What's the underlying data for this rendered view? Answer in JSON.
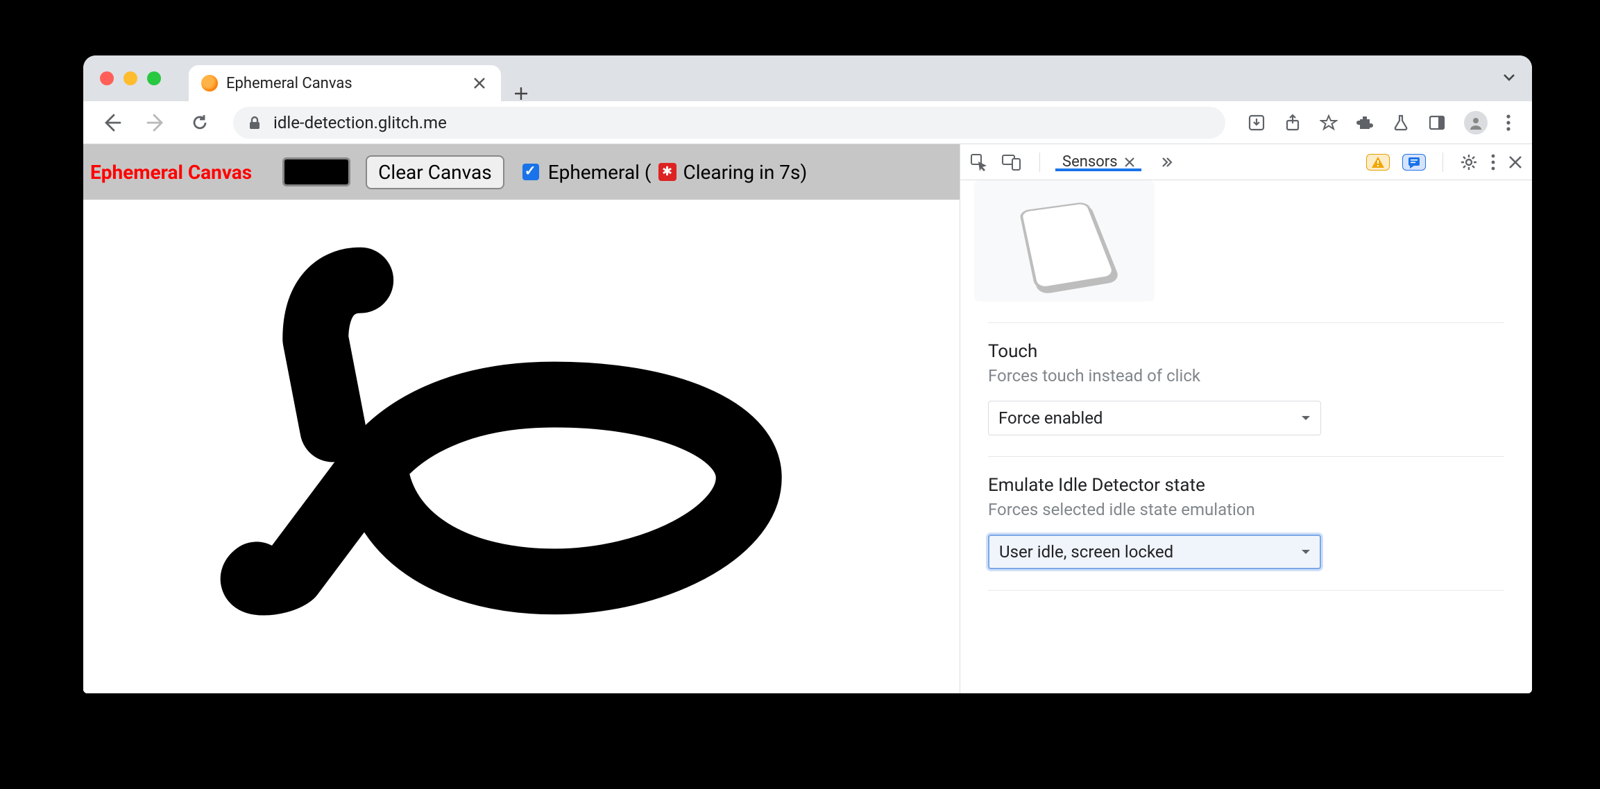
{
  "browser": {
    "tab_title": "Ephemeral Canvas",
    "url": "idle-detection.glitch.me"
  },
  "page": {
    "heading": "Ephemeral Canvas",
    "clear_button": "Clear Canvas",
    "ephemeral_prefix": "Ephemeral (",
    "ephemeral_countdown": " Clearing in 7s)",
    "ephemeral_checked": true
  },
  "devtools": {
    "active_tab": "Sensors",
    "touch": {
      "title": "Touch",
      "subtitle": "Forces touch instead of click",
      "value": "Force enabled"
    },
    "idle": {
      "title": "Emulate Idle Detector state",
      "subtitle": "Forces selected idle state emulation",
      "value": "User idle, screen locked"
    }
  }
}
